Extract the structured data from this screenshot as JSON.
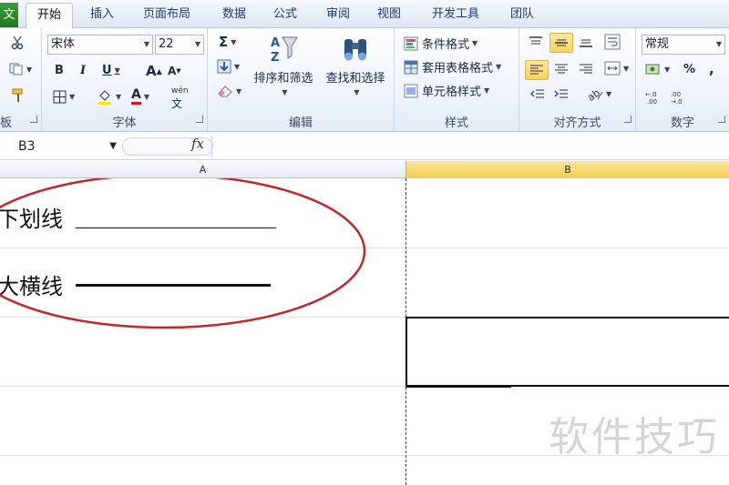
{
  "tabs": {
    "file": "文",
    "items": [
      "开始",
      "插入",
      "页面布局",
      "数据",
      "公式",
      "审阅",
      "视图",
      "开发工具",
      "团队"
    ],
    "active": "开始"
  },
  "ribbon": {
    "clipboard": {
      "label": "板"
    },
    "font": {
      "label": "字体",
      "name": "宋体",
      "size": "22",
      "bold": "B",
      "italic": "I",
      "underline": "U",
      "grow": "A",
      "shrink": "A",
      "color_a": "A",
      "wen": "wén"
    },
    "editing": {
      "label": "编辑",
      "sort_filter": "排序和筛选",
      "find_select": "查找和选择",
      "sigma": "Σ"
    },
    "styles": {
      "label": "样式",
      "conditional": "条件格式",
      "table_format": "套用表格格式",
      "cell_styles": "单元格样式"
    },
    "alignment": {
      "label": "对齐方式"
    },
    "number": {
      "label": "数字",
      "format": "常规",
      "percent": "%",
      "comma": ","
    }
  },
  "formula_bar": {
    "name_box": "B3",
    "fx": "fx",
    "value": ""
  },
  "sheet": {
    "col_a": "A",
    "col_b": "B",
    "row1_text": "下划线",
    "row2_text": "大横线"
  },
  "watermark": "软件技巧",
  "colors": {
    "accent_selected": "#f4cf55",
    "ellipse": "#c0282e",
    "file_tab": "#2a8a28"
  }
}
